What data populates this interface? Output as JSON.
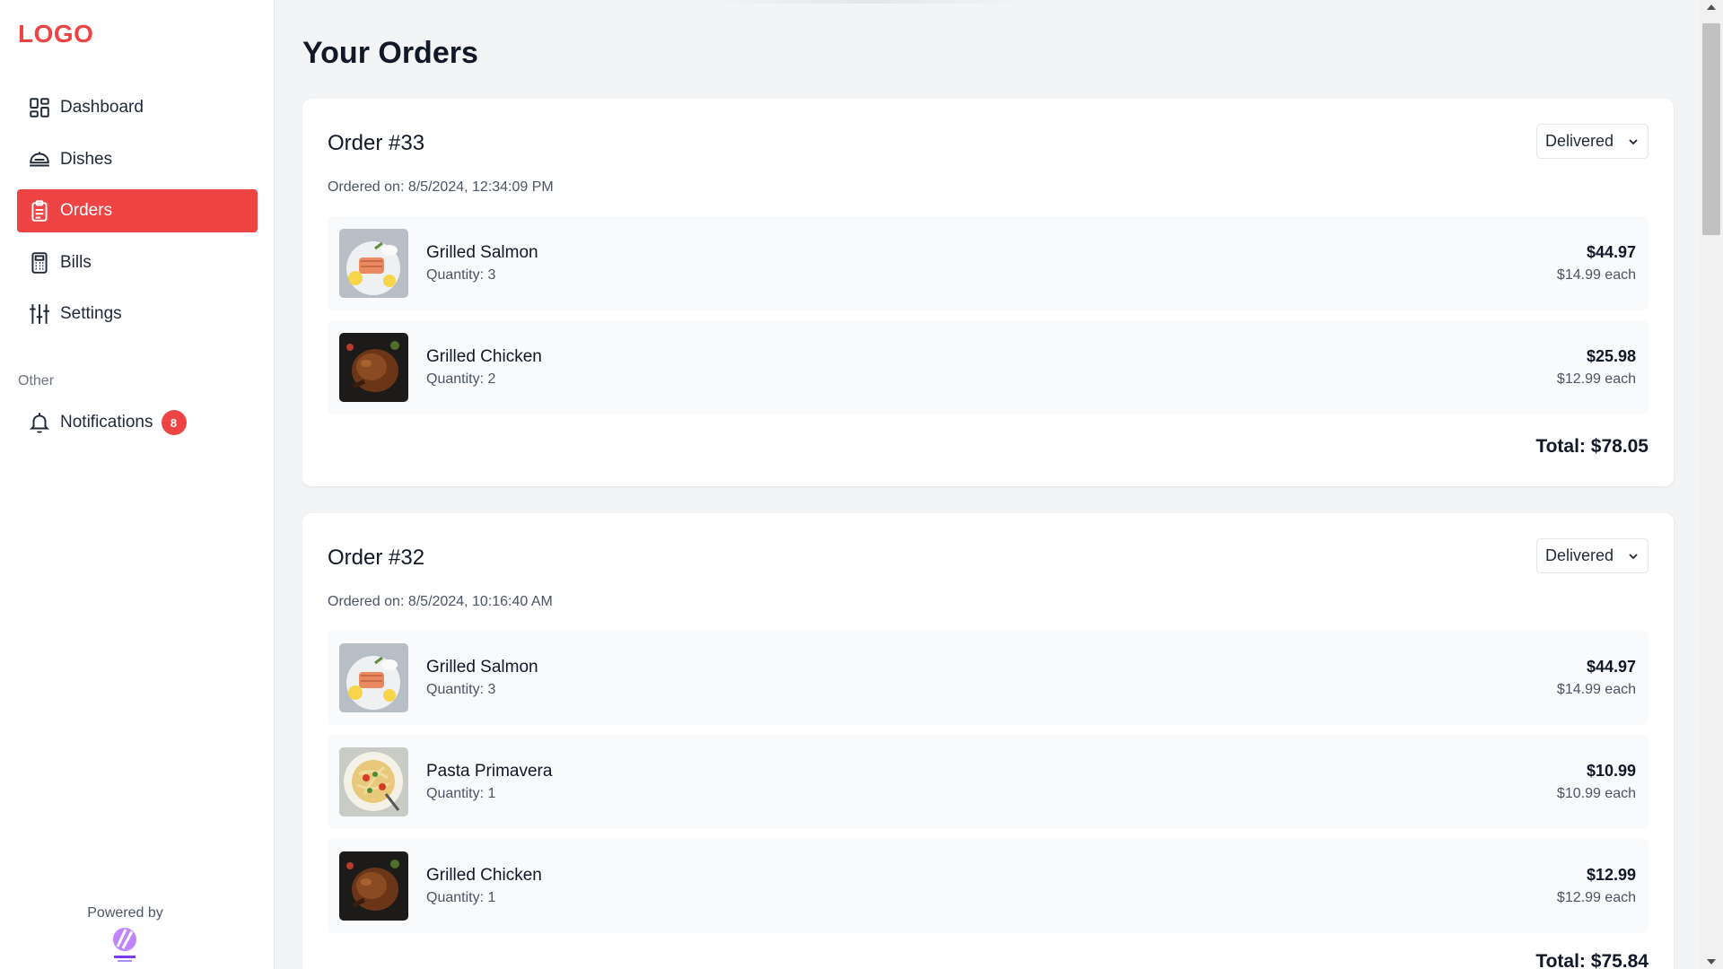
{
  "sidebar": {
    "logo": "LOGO",
    "nav": [
      {
        "label": "Dashboard",
        "icon": "dashboard-icon"
      },
      {
        "label": "Dishes",
        "icon": "dish-icon"
      },
      {
        "label": "Orders",
        "icon": "clipboard-icon",
        "active": true
      },
      {
        "label": "Bills",
        "icon": "calculator-icon"
      },
      {
        "label": "Settings",
        "icon": "sliders-icon"
      }
    ],
    "other_label": "Other",
    "notifications": {
      "label": "Notifications",
      "count": "8",
      "icon": "bell-icon"
    },
    "powered_by": "Powered by",
    "brand_icon": "brand-logo-icon"
  },
  "main": {
    "title": "Your Orders",
    "orders": [
      {
        "title": "Order #33",
        "status": "Delivered",
        "ordered_on": "Ordered on: 8/5/2024, 12:34:09 PM",
        "items": [
          {
            "name": "Grilled Salmon",
            "quantity": "Quantity: 3",
            "total": "$44.97",
            "each": "$14.99 each",
            "image": "salmon-image"
          },
          {
            "name": "Grilled Chicken",
            "quantity": "Quantity: 2",
            "total": "$25.98",
            "each": "$12.99 each",
            "image": "chicken-image"
          }
        ],
        "total": "Total: $78.05"
      },
      {
        "title": "Order #32",
        "status": "Delivered",
        "ordered_on": "Ordered on: 8/5/2024, 10:16:40 AM",
        "items": [
          {
            "name": "Grilled Salmon",
            "quantity": "Quantity: 3",
            "total": "$44.97",
            "each": "$14.99 each",
            "image": "salmon-image"
          },
          {
            "name": "Pasta Primavera",
            "quantity": "Quantity: 1",
            "total": "$10.99",
            "each": "$10.99 each",
            "image": "pasta-image"
          },
          {
            "name": "Grilled Chicken",
            "quantity": "Quantity: 1",
            "total": "$12.99",
            "each": "$12.99 each",
            "image": "chicken-image"
          }
        ],
        "total": "Total: $75.84"
      }
    ]
  },
  "colors": {
    "accent": "#ef4444",
    "background": "#f3f4f6",
    "card": "#ffffff",
    "item_bg": "#f9fafb"
  }
}
